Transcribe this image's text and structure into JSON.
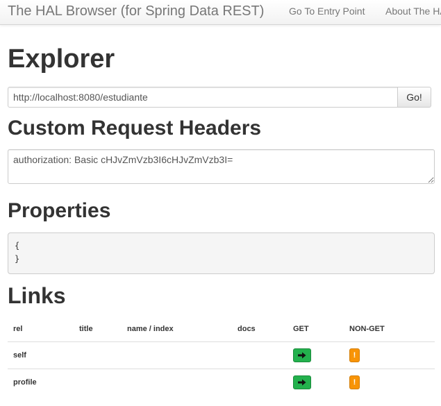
{
  "navbar": {
    "brand": "The HAL Browser (for Spring Data REST)",
    "links": [
      "Go To Entry Point",
      "About The HAL Browser"
    ]
  },
  "explorer": {
    "title": "Explorer",
    "url_value": "http://localhost:8080/estudiante",
    "go_label": "Go!"
  },
  "custom_headers": {
    "title": "Custom Request Headers",
    "value": "authorization: Basic cHJvZmVzb3I6cHJvZmVzb3I="
  },
  "properties": {
    "title": "Properties",
    "lines": [
      "{",
      "}"
    ]
  },
  "links": {
    "title": "Links",
    "columns": [
      "rel",
      "title",
      "name / index",
      "docs",
      "GET",
      "NON-GET"
    ],
    "rows": [
      {
        "rel": "self",
        "title": "",
        "name": "",
        "docs": "",
        "nonget_label": "!"
      },
      {
        "rel": "profile",
        "title": "",
        "name": "",
        "docs": "",
        "nonget_label": "!"
      }
    ]
  },
  "icons": {
    "get": "arrow-right-icon",
    "nonget": "exclamation-icon"
  },
  "colors": {
    "get_button": "#23b14d",
    "nonget_button": "#f89406"
  }
}
